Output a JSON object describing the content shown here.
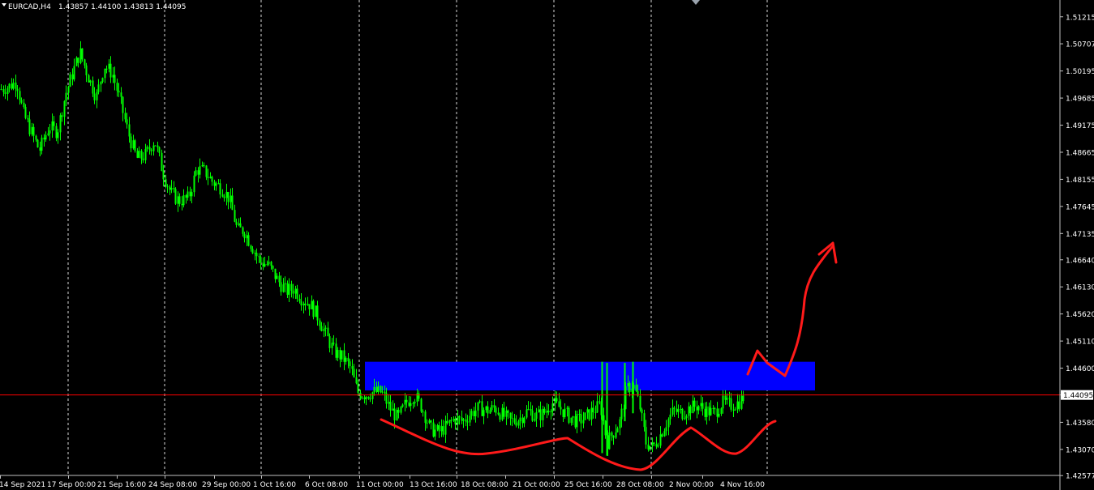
{
  "header": {
    "symbol": "EURCAD,H4",
    "ohlc": "1.43857 1.44100 1.43813 1.44095"
  },
  "colors": {
    "background": "#000000",
    "candle": "#00ff00",
    "grid": "#ffffff",
    "axis": "#c0c0c0",
    "text": "#ffffff",
    "zone": "#0000ff",
    "bid_line": "#ff0000",
    "drawing": "#ff1a1a"
  },
  "chart_data": {
    "type": "candlestick",
    "title": "",
    "xlabel": "",
    "ylabel": "",
    "ylim": [
      1.4258,
      1.5144
    ],
    "grid": "vertical dashed",
    "y_ticks": [
      "1.51215",
      "1.50707",
      "1.50195",
      "1.49685",
      "1.49175",
      "1.48665",
      "1.48155",
      "1.47645",
      "1.47135",
      "1.46640",
      "1.46130",
      "1.45620",
      "1.45110",
      "1.44600",
      "1.44095",
      "1.43580",
      "1.43070",
      "1.42577"
    ],
    "x_ticks": [
      "14 Sep 2021",
      "17 Sep 00:00",
      "21 Sep 16:00",
      "24 Sep 08:00",
      "29 Sep 00:00",
      "1 Oct 16:00",
      "6 Oct 08:00",
      "11 Oct 00:00",
      "13 Oct 16:00",
      "18 Oct 08:00",
      "21 Oct 00:00",
      "25 Oct 16:00",
      "28 Oct 08:00",
      "2 Nov 00:00",
      "4 Nov 16:00"
    ],
    "current_price": 1.44095,
    "resistance_zone": [
      1.4418,
      1.4472
    ],
    "price_path": [
      [
        0,
        1.4985
      ],
      [
        10,
        1.499
      ],
      [
        20,
        1.5
      ],
      [
        28,
        1.494
      ],
      [
        38,
        1.4905
      ],
      [
        48,
        1.487
      ],
      [
        60,
        1.4915
      ],
      [
        70,
        1.4905
      ],
      [
        80,
        1.4975
      ],
      [
        90,
        1.502
      ],
      [
        98,
        1.5055
      ],
      [
        108,
        1.501
      ],
      [
        118,
        1.497
      ],
      [
        128,
        1.503
      ],
      [
        138,
        1.5015
      ],
      [
        148,
        1.496
      ],
      [
        158,
        1.49
      ],
      [
        168,
        1.4855
      ],
      [
        178,
        1.486
      ],
      [
        190,
        1.489
      ],
      [
        200,
        1.483
      ],
      [
        210,
        1.479
      ],
      [
        220,
        1.4775
      ],
      [
        232,
        1.478
      ],
      [
        242,
        1.4835
      ],
      [
        252,
        1.483
      ],
      [
        262,
        1.481
      ],
      [
        272,
        1.48
      ],
      [
        282,
        1.478
      ],
      [
        292,
        1.472
      ],
      [
        300,
        1.472
      ],
      [
        310,
        1.469
      ],
      [
        320,
        1.466
      ],
      [
        330,
        1.4655
      ],
      [
        342,
        1.4625
      ],
      [
        352,
        1.4605
      ],
      [
        362,
        1.461
      ],
      [
        372,
        1.459
      ],
      [
        382,
        1.458
      ],
      [
        392,
        1.4555
      ],
      [
        402,
        1.452
      ],
      [
        412,
        1.449
      ],
      [
        422,
        1.448
      ],
      [
        432,
        1.446
      ],
      [
        440,
        1.4415
      ],
      [
        450,
        1.441
      ],
      [
        460,
        1.4415
      ],
      [
        470,
        1.4415
      ],
      [
        480,
        1.4385
      ],
      [
        490,
        1.4365
      ],
      [
        500,
        1.4395
      ],
      [
        510,
        1.441
      ],
      [
        520,
        1.4385
      ],
      [
        530,
        1.4345
      ],
      [
        540,
        1.434
      ],
      [
        550,
        1.435
      ],
      [
        560,
        1.4365
      ],
      [
        570,
        1.436
      ],
      [
        580,
        1.4375
      ],
      [
        590,
        1.4385
      ],
      [
        600,
        1.438
      ],
      [
        610,
        1.4385
      ],
      [
        620,
        1.437
      ],
      [
        630,
        1.436
      ],
      [
        640,
        1.4365
      ],
      [
        650,
        1.438
      ],
      [
        660,
        1.437
      ],
      [
        670,
        1.4375
      ],
      [
        680,
        1.4395
      ],
      [
        690,
        1.4385
      ],
      [
        700,
        1.437
      ],
      [
        710,
        1.436
      ],
      [
        720,
        1.4365
      ],
      [
        730,
        1.438
      ],
      [
        740,
        1.439
      ],
      [
        748,
        1.432
      ],
      [
        756,
        1.434
      ],
      [
        764,
        1.436
      ],
      [
        772,
        1.442
      ],
      [
        780,
        1.443
      ],
      [
        788,
        1.439
      ],
      [
        796,
        1.432
      ],
      [
        804,
        1.431
      ],
      [
        812,
        1.433
      ],
      [
        820,
        1.4355
      ],
      [
        830,
        1.438
      ],
      [
        840,
        1.4375
      ],
      [
        850,
        1.4385
      ],
      [
        860,
        1.439
      ],
      [
        870,
        1.438
      ],
      [
        880,
        1.4375
      ],
      [
        890,
        1.4395
      ],
      [
        900,
        1.439
      ],
      [
        910,
        1.4395
      ],
      [
        918,
        1.4408
      ]
    ]
  }
}
